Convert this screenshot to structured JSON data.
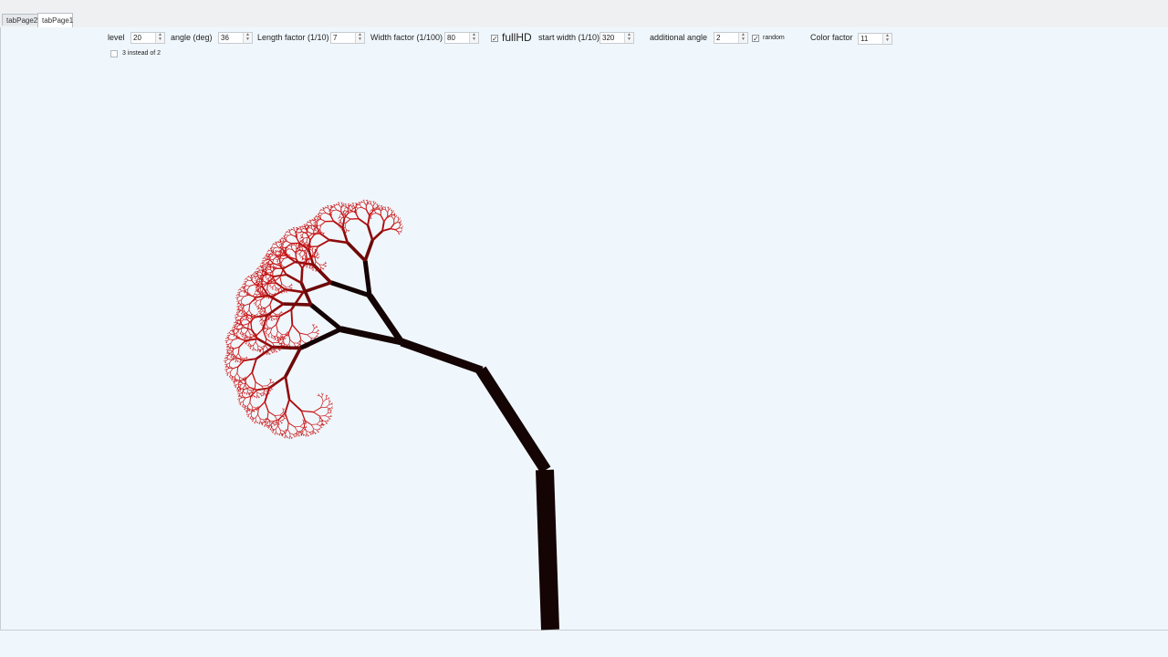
{
  "tabs": [
    {
      "label": "tabPage2"
    },
    {
      "label": "tabPage1",
      "active": true
    }
  ],
  "controls": {
    "level": {
      "label": "level",
      "value": "20"
    },
    "angle": {
      "label": "angle (deg)",
      "value": "36"
    },
    "length_factor": {
      "label": "Length factor (1/10)",
      "value": "7"
    },
    "width_factor": {
      "label": "Width factor (1/100)",
      "value": "80"
    },
    "fullhd": {
      "label": "fullHD",
      "checked": true
    },
    "start_width": {
      "label": "start width (1/10)",
      "value": "320"
    },
    "additional_angle": {
      "label": "additional angle",
      "value": "2"
    },
    "random": {
      "label": "random",
      "checked": true
    },
    "color_factor": {
      "label": "Color factor",
      "value": "11"
    },
    "three_instead": {
      "label": "3 instead of 2",
      "checked": false
    }
  },
  "canvas": {
    "trunk_color": "#140404",
    "leaf_color": "#c81010",
    "background": "#f0f7fc"
  }
}
